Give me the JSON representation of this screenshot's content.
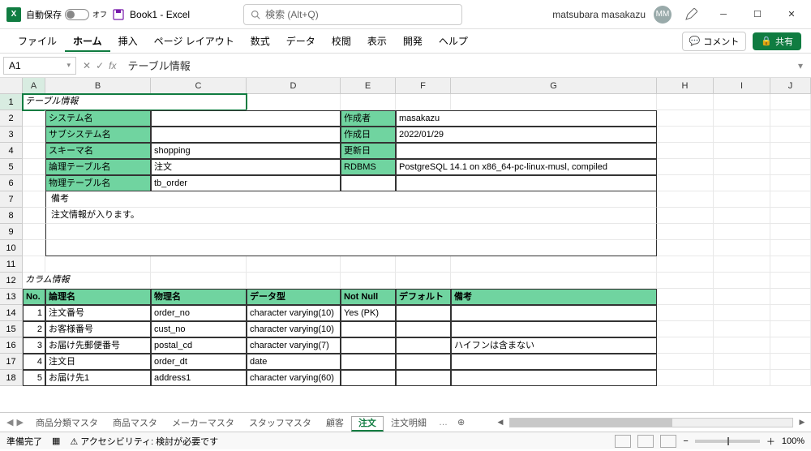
{
  "titlebar": {
    "autosave_label": "自動保存",
    "autosave_state": "オフ",
    "doc_title": "Book1 - Excel",
    "search_placeholder": "検索 (Alt+Q)",
    "user_name": "matsubara masakazu",
    "user_initials": "MM"
  },
  "ribbon": {
    "tabs": [
      "ファイル",
      "ホーム",
      "挿入",
      "ページ レイアウト",
      "数式",
      "データ",
      "校閲",
      "表示",
      "開発",
      "ヘルプ"
    ],
    "active": 1,
    "comment": "コメント",
    "share": "共有"
  },
  "formula_bar": {
    "namebox": "A1",
    "fx": "fx",
    "value": "テーブル情報"
  },
  "columns": [
    "A",
    "B",
    "C",
    "D",
    "E",
    "F",
    "G",
    "H",
    "I",
    "J"
  ],
  "sheet": {
    "section1_title": "テーブル情報",
    "labels": {
      "system": "システム名",
      "subsystem": "サブシステム名",
      "schema": "スキーマ名",
      "logical_table": "論理テーブル名",
      "physical_table": "物理テーブル名",
      "author": "作成者",
      "created": "作成日",
      "updated": "更新日",
      "rdbms": "RDBMS",
      "note": "備考"
    },
    "values": {
      "system": "",
      "subsystem": "",
      "schema": "shopping",
      "logical_table": "注文",
      "physical_table": "tb_order",
      "author": "masakazu",
      "created": "2022/01/29",
      "updated": "",
      "rdbms": "PostgreSQL 14.1 on x86_64-pc-linux-musl, compiled",
      "note_text": "注文情報が入ります。"
    },
    "section2_title": "カラム情報",
    "col_headers": [
      "No.",
      "論理名",
      "物理名",
      "データ型",
      "Not Null",
      "デフォルト",
      "備考"
    ],
    "cols": [
      {
        "no": "1",
        "logical": "注文番号",
        "physical": "order_no",
        "type": "character varying(10)",
        "notnull": "Yes (PK)",
        "def": "",
        "note": ""
      },
      {
        "no": "2",
        "logical": "お客様番号",
        "physical": "cust_no",
        "type": "character varying(10)",
        "notnull": "",
        "def": "",
        "note": ""
      },
      {
        "no": "3",
        "logical": "お届け先郵便番号",
        "physical": "postal_cd",
        "type": "character varying(7)",
        "notnull": "",
        "def": "",
        "note": "ハイフンは含まない"
      },
      {
        "no": "4",
        "logical": "注文日",
        "physical": "order_dt",
        "type": "date",
        "notnull": "",
        "def": "",
        "note": ""
      },
      {
        "no": "5",
        "logical": "お届け先1",
        "physical": "address1",
        "type": "character varying(60)",
        "notnull": "",
        "def": "",
        "note": ""
      }
    ]
  },
  "sheet_tabs": [
    "商品分類マスタ",
    "商品マスタ",
    "メーカーマスタ",
    "スタッフマスタ",
    "顧客",
    "注文",
    "注文明細"
  ],
  "sheet_active": 5,
  "status": {
    "ready": "準備完了",
    "accessibility": "アクセシビリティ: 検討が必要です",
    "zoom": "100%"
  }
}
